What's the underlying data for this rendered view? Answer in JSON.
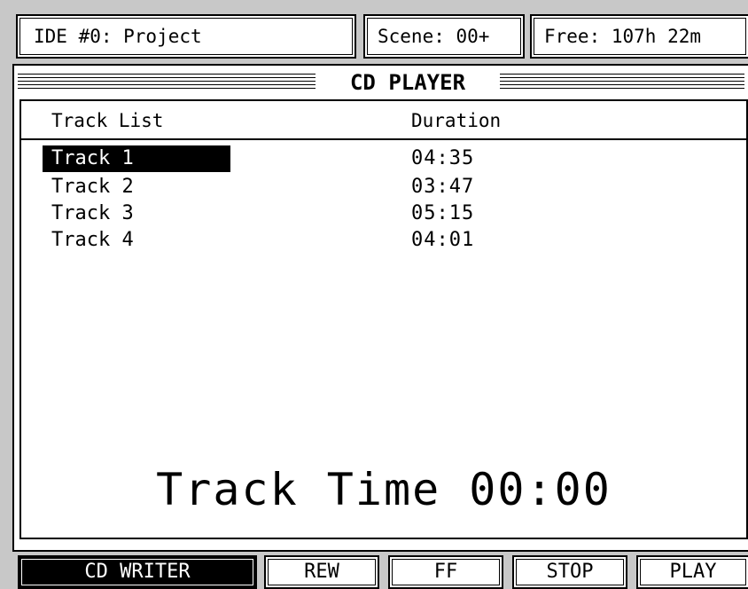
{
  "header": {
    "project": "IDE #0: Project",
    "scene": "Scene: 00+",
    "free": "Free: 107h 22m"
  },
  "panel": {
    "title": "CD PLAYER",
    "columns": {
      "track": "Track List",
      "duration": "Duration"
    },
    "tracks": [
      {
        "name": "Track 1",
        "duration": "04:35",
        "selected": true
      },
      {
        "name": "Track 2",
        "duration": "03:47",
        "selected": false
      },
      {
        "name": "Track 3",
        "duration": "05:15",
        "selected": false
      },
      {
        "name": "Track 4",
        "duration": "04:01",
        "selected": false
      }
    ],
    "track_time": "Track Time 00:00"
  },
  "softkeys": {
    "cd_writer": "CD WRITER",
    "rew": "REW",
    "ff": "FF",
    "stop": "STOP",
    "play": "PLAY"
  },
  "colors": {
    "background": "#c8c8c8",
    "panel": "#ffffff",
    "ink": "#000000"
  }
}
